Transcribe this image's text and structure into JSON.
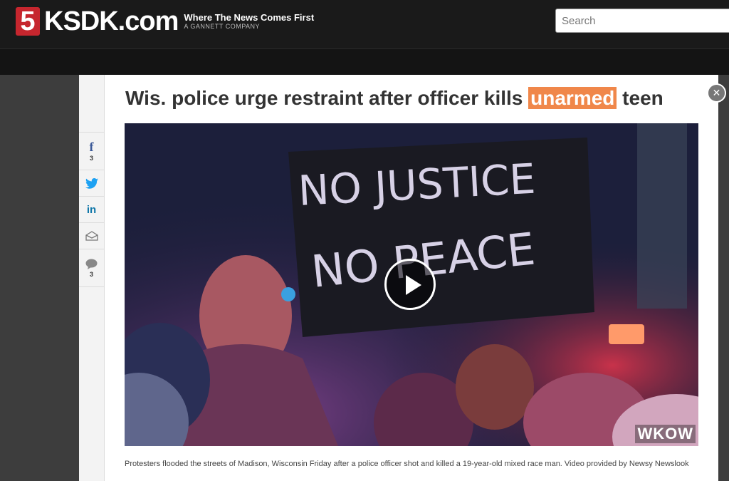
{
  "header": {
    "logo_number": "5",
    "logo_text": "KSDK.com",
    "tagline": "Where The News Comes First",
    "subtagline": "A GANNETT COMPANY",
    "search_placeholder": "Search"
  },
  "share": {
    "facebook_count": "3",
    "comments_count": "3"
  },
  "article": {
    "headline_before": "Wis. police urge restraint after officer kills ",
    "headline_highlight": "unarmed",
    "headline_after": " teen",
    "video_watermark": "WKOW",
    "sign_line_1": "NO JUSTICE",
    "sign_line_2": "NO PEACE",
    "caption": "Protesters flooded the streets of Madison, Wisconsin Friday after a police officer shot and killed a 19-year-old mixed race man. Video provided by Newsy Newslook"
  },
  "colors": {
    "highlight": "#f0874a",
    "logo_red": "#c6262e",
    "facebook": "#3b5998",
    "twitter": "#1da1f2",
    "linkedin": "#0e76a8"
  }
}
